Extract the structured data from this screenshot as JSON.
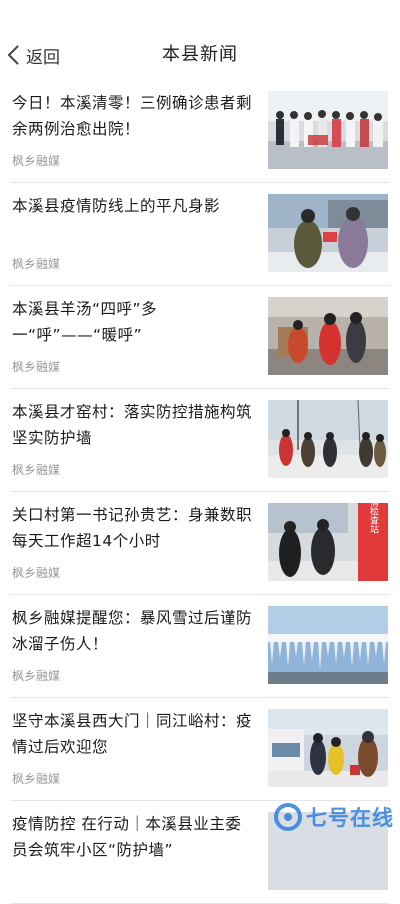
{
  "nav": {
    "back_label": "返回",
    "title": "本县新闻"
  },
  "articles": [
    {
      "title": "今日！本溪清零！三例确诊患者剩余两例治愈出院！",
      "source": "枫乡融媒"
    },
    {
      "title": "本溪县疫情防线上的平凡身影",
      "source": "枫乡融媒"
    },
    {
      "title": "本溪县羊汤“四呼”多一“呼”——“暖呼”",
      "source": "枫乡融媒"
    },
    {
      "title": "本溪县才窑村：落实防控措施构筑坚实防护墙",
      "source": "枫乡融媒"
    },
    {
      "title": "关口村第一书记孙贵艺：身兼数职 每天工作超14个小时",
      "source": "枫乡融媒"
    },
    {
      "title": "枫乡融媒提醒您：暴风雪过后谨防冰溜子伤人！",
      "source": "枫乡融媒"
    },
    {
      "title": "坚守本溪县西大门｜同江峪村：疫情过后欢迎您",
      "source": "枫乡融媒"
    },
    {
      "title": "疫情防控 在行动｜本溪县业主委员会筑牢小区“防护墙”",
      "source": ""
    }
  ],
  "images": {
    "thumb_sign_text": "疫情检查站"
  },
  "watermark": {
    "text": "七号在线"
  },
  "colors": {
    "accent": "#2f7fe0",
    "source_gray": "#999999",
    "divider": "#e6e6e6"
  }
}
